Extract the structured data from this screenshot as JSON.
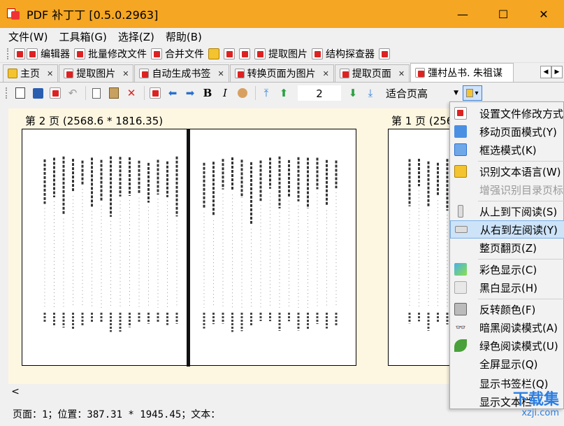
{
  "window": {
    "title": "PDF 补丁丁 [0.5.0.2963]",
    "minimize": "—",
    "maximize": "☐",
    "close": "✕"
  },
  "menubar": {
    "items": [
      "文件(W)",
      "工具箱(G)",
      "选择(Z)",
      "帮助(B)"
    ]
  },
  "plugins": {
    "items": [
      "编辑器",
      "批量修改文件",
      "合并文件",
      "提取图片",
      "结构探查器"
    ]
  },
  "tabs": [
    {
      "label": "主页"
    },
    {
      "label": "提取图片"
    },
    {
      "label": "自动生成书签"
    },
    {
      "label": "转换页面为图片"
    },
    {
      "label": "提取页面"
    },
    {
      "label": "彊村丛书. 朱祖谋"
    }
  ],
  "toolbar": {
    "page_number": "2",
    "zoom": "适合页高"
  },
  "document": {
    "left_page_label": "第 2 页 (2568.6 * 1816.35)",
    "right_page_label": "第 1 页 (256"
  },
  "status": {
    "text": "页面：1；位置：387.31 * 1945.45；文本："
  },
  "context_menu": {
    "items": [
      {
        "label": "设置文件修改方式(",
        "state": "normal"
      },
      {
        "label": "移动页面模式(Y)",
        "state": "normal"
      },
      {
        "label": "框选模式(K)",
        "state": "normal"
      },
      {
        "label": "识别文本语言(W)",
        "state": "normal"
      },
      {
        "label": "增强识别目录页标志",
        "state": "disabled"
      },
      {
        "label": "从上到下阅读(S)",
        "state": "normal"
      },
      {
        "label": "从右到左阅读(Y)",
        "state": "selected"
      },
      {
        "label": "整页翻页(Z)",
        "state": "normal"
      },
      {
        "label": "彩色显示(C)",
        "state": "normal"
      },
      {
        "label": "黑白显示(H)",
        "state": "normal"
      },
      {
        "label": "反转颜色(F)",
        "state": "normal"
      },
      {
        "label": "暗黑阅读模式(A)",
        "state": "normal"
      },
      {
        "label": "绿色阅读模式(U)",
        "state": "normal"
      },
      {
        "label": "全屏显示(Q)",
        "state": "normal"
      },
      {
        "label": "显示书签栏(Q)",
        "state": "normal"
      },
      {
        "label": "显示文本栏",
        "state": "normal"
      }
    ]
  },
  "watermark": {
    "text": "下载集",
    "url": "xzji.com"
  },
  "colors": {
    "titlebar": "#f5a623",
    "canvas": "#fdf7e2",
    "selection": "#cde3f8"
  }
}
